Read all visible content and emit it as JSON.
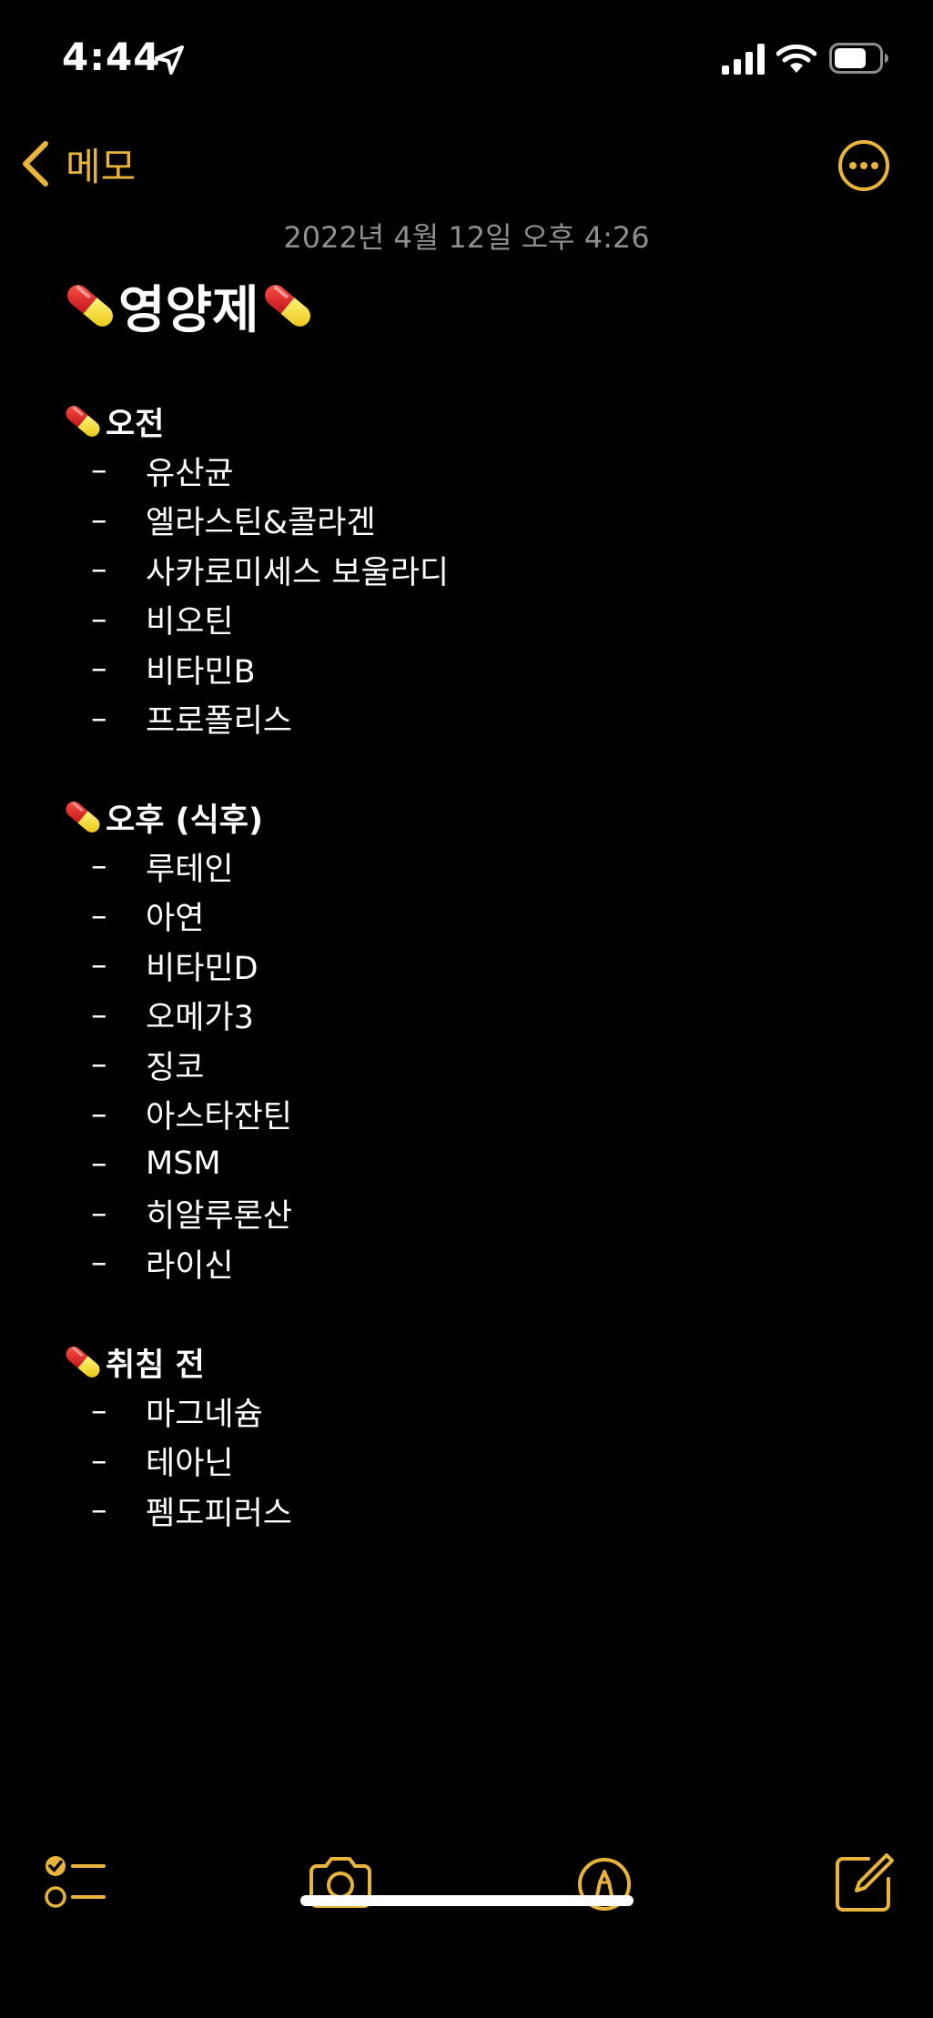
{
  "status_bar": {
    "time": "4:44",
    "icons": [
      "location-arrow-icon",
      "cellular-signal-icon",
      "wifi-icon",
      "battery-icon"
    ]
  },
  "nav": {
    "back_label": "메모",
    "more_icon": "ellipsis-circle-icon"
  },
  "note": {
    "date": "2022년 4월 12일 오후 4:26",
    "title": "영양제",
    "sections": [
      {
        "heading": "오전",
        "items": [
          "유산균",
          "엘라스틴&콜라겐",
          "사카로미세스 보울라디",
          "비오틴",
          "비타민B",
          "프로폴리스"
        ]
      },
      {
        "heading": "오후 (식후)",
        "items": [
          "루테인",
          "아연",
          "비타민D",
          "오메가3",
          "징코",
          "아스타잔틴",
          "MSM",
          "히알루론산",
          "라이신"
        ]
      },
      {
        "heading": "취침 전",
        "items": [
          "마그네슘",
          "테아닌",
          "펨도피러스"
        ]
      }
    ],
    "list_marker": "–"
  },
  "toolbar": {
    "icons": [
      "checklist-icon",
      "camera-icon",
      "markup-pen-icon",
      "compose-icon"
    ]
  },
  "colors": {
    "accent": "#e8b53a",
    "background": "#000000",
    "text": "#ffffff",
    "secondary_text": "#8e8e93"
  }
}
